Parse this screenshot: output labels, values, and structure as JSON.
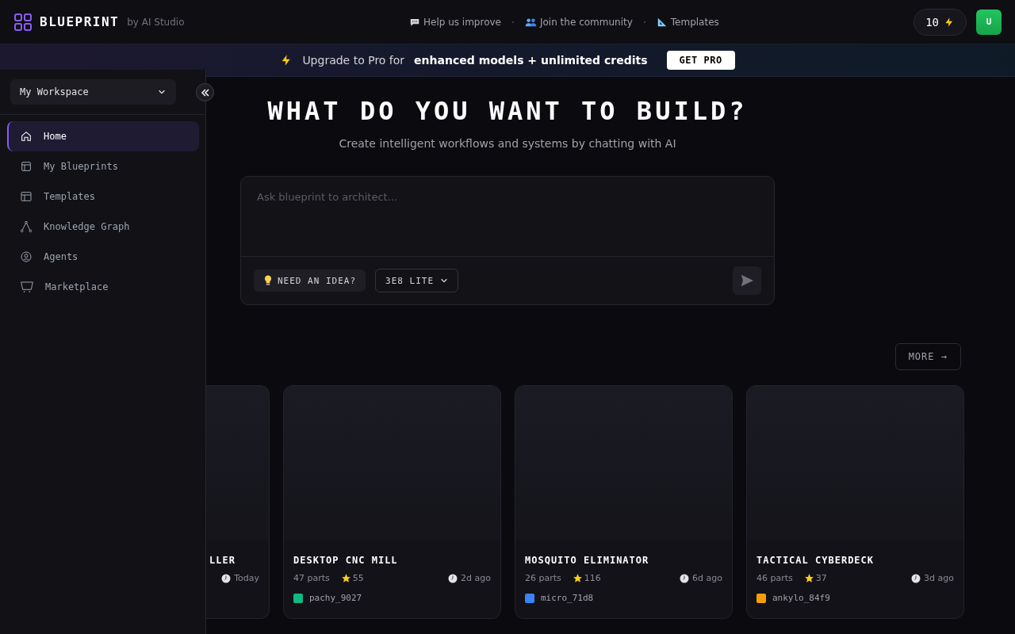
{
  "header": {
    "logo": "BLUEPRINT",
    "byline": "by AI Studio",
    "links": [
      {
        "kind": "chat",
        "label": "Help us improve"
      },
      {
        "kind": "people",
        "label": "Join the community"
      },
      {
        "kind": "ruler",
        "label": "Templates"
      }
    ],
    "credits": "10",
    "avatar": "U"
  },
  "banner": {
    "text": "Upgrade to Pro for",
    "highlight": "enhanced models + unlimited credits",
    "button": "GET PRO"
  },
  "sidebar": {
    "workspace": "My Workspace",
    "items": [
      {
        "kind": "home",
        "label": "Home",
        "selected": true
      },
      {
        "kind": "blueprints",
        "label": "My Blueprints",
        "selected": false
      },
      {
        "kind": "templates",
        "label": "Templates",
        "selected": false
      },
      {
        "kind": "graph",
        "label": "Knowledge Graph",
        "selected": false
      },
      {
        "kind": "agent",
        "label": "Agents",
        "selected": false
      },
      {
        "kind": "cart",
        "label": "Marketplace",
        "selected": false
      }
    ]
  },
  "hero": {
    "title": "WHAT DO YOU WANT TO BUILD?",
    "subtitle": "Create intelligent workflows and systems by chatting with AI"
  },
  "prompt": {
    "placeholder": "Ask blueprint to architect...",
    "idea_button": "NEED AN IDEA?",
    "model": "3E8 LITE"
  },
  "more_button": "MORE →",
  "cards": [
    {
      "kind": "partial",
      "title": "LLER",
      "time": "Today"
    },
    {
      "kind": "full",
      "title": "DESKTOP CNC MILL",
      "parts": "47 parts",
      "rating": "55",
      "time": "2d ago",
      "author": "pachy_9027",
      "color": "#10b981"
    },
    {
      "kind": "full",
      "title": "MOSQUITO ELIMINATOR",
      "parts": "26 parts",
      "rating": "116",
      "time": "6d ago",
      "author": "micro_71d8",
      "color": "#3b82f6"
    },
    {
      "kind": "full",
      "title": "TACTICAL CYBERDECK",
      "parts": "46 parts",
      "rating": "37",
      "time": "3d ago",
      "author": "ankylo_84f9",
      "color": "#f59e0b"
    }
  ]
}
